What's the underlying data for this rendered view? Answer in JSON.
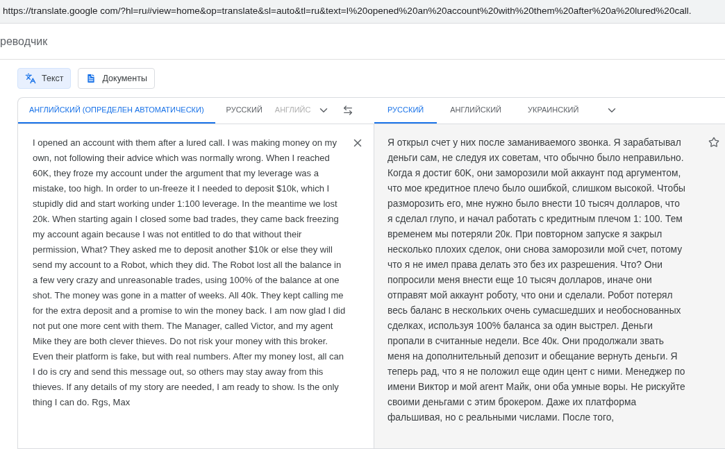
{
  "address_bar": {
    "url": "https://translate.google com/?hl=ru#view=home&op=translate&sl=auto&tl=ru&text=I%20opened%20an%20account%20with%20them%20after%20a%20lured%20call."
  },
  "header": {
    "title": "реводчик"
  },
  "mode_buttons": [
    {
      "label": "Текст",
      "kind": "text",
      "selected": true
    },
    {
      "label": "Документы",
      "kind": "document",
      "selected": false
    }
  ],
  "source_tabs": [
    {
      "label": "АНГЛИЙСКИЙ (ОПРЕДЕЛЕН АВТОМАТИЧЕСКИ)",
      "selected": true,
      "faded": false
    },
    {
      "label": "РУССКИЙ",
      "selected": false,
      "faded": false
    },
    {
      "label": "АНГЛИЙС",
      "selected": false,
      "faded": true
    }
  ],
  "target_tabs": [
    {
      "label": "РУССКИЙ",
      "selected": true
    },
    {
      "label": "АНГЛИЙСКИЙ",
      "selected": false
    },
    {
      "label": "УКРАИНСКИЙ",
      "selected": false
    }
  ],
  "source_text": "I opened an account with them after a lured call. I was making money on my own, not following their advice which was normally wrong. When I reached 60K, they froze my account under the argument that my leverage was a mistake, too high. In order to un-freeze it I needed to deposit $10k, which I stupidly did and start working under 1:100 leverage. In the meantime we lost 20k. When starting again I closed some bad trades, they came back freezing my account again because I was not entitled to do that without their permission, What? They asked me to deposit another $10k or else they will send my account to a Robot, which they did. The Robot lost all the balance in a few very crazy and unreasonable trades, using 100% of the balance at one shot. The money was gone in a matter of weeks. All 40k. They kept calling me for the extra deposit and a promise to win the money back. I am now glad I did not put one more cent with them. The Manager, called Victor, and my agent Mike they are both clever thieves. Do not risk your money with this broker. Even their platform is fake, but with real numbers. After my money lost, all can I do is cry and send this message out, so others may stay away from this thieves. If any details of my story are needed, I am ready to show. Is the only thing I can do. Rgs, Max",
  "translation": "Я открыл счет у них после заманиваемого звонка. Я зарабатывал деньги сам, не следуя их советам, что обычно было неправильно. Когда я достиг 60K, они заморозили мой аккаунт под аргументом, что мое кредитное плечо было ошибкой, слишком высокой. Чтобы разморозить его, мне нужно было внести 10 тысяч долларов, что я сделал глупо, и начал работать с кредитным плечом 1: 100. Тем временем мы потеряли 20к. При повторном запуске я закрыл несколько плохих сделок, они снова заморозили мой счет, потому что я не имел права делать это без их разрешения. Что? Они попросили меня внести еще 10 тысяч долларов, иначе они отправят мой аккаунт роботу, что они и сделали. Робот потерял весь баланс в нескольких очень сумасшедших и необоснованных сделках, используя 100% баланса за один выстрел. Деньги пропали в считанные недели. Все 40к. Они продолжали звать меня на дополнительный депозит и обещание вернуть деньги. Я теперь рад, что я не положил еще один цент с ними. Менеджер по имени Виктор и мой агент Майк, они оба умные воры. Не рискуйте своими деньгами с этим брокером. Даже их платформа фальшивая, но с реальными числами. После того,"
}
